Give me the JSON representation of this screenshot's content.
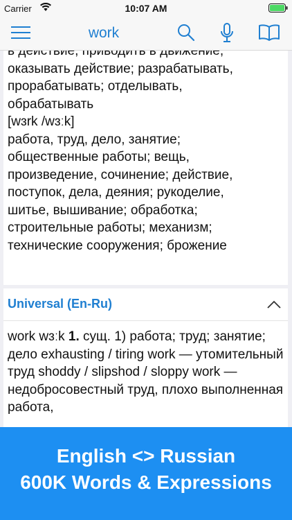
{
  "status_bar": {
    "carrier": "Carrier",
    "time": "10:07 AM"
  },
  "nav": {
    "title": "work"
  },
  "entry1": {
    "text": "в действие, приводить в движение,\nоказывать действие; разрабатывать,\nпрорабатывать; отделывать,\nобрабатывать\n[wɜrk /wɜːk]\nработа, труд, дело, занятие;\nобщественные работы; вещь,\nпроизведение, сочинение; действие,\nпоступок, дела, деяния; рукоделие,\nшитье, вышивание; обработка;\nстроительные работы; механизм;\nтехнические сооружения; брожение"
  },
  "entry2": {
    "dictionary": "Universal (En-Ru)",
    "headword": "work wɜːk ",
    "sense_number": "1.",
    "body": " сущ. 1) работа; труд; занятие; дело exhausting / tiring work — утомительный труд shoddy / slipshod / sloppy work — недобросовестный труд, плохо выполненная работа,"
  },
  "banner": {
    "line1": "English <> Russian",
    "line2": "600K Words & Expressions"
  },
  "colors": {
    "accent": "#1f7fd1",
    "banner": "#1d8ff2",
    "battery": "#4cd964"
  }
}
